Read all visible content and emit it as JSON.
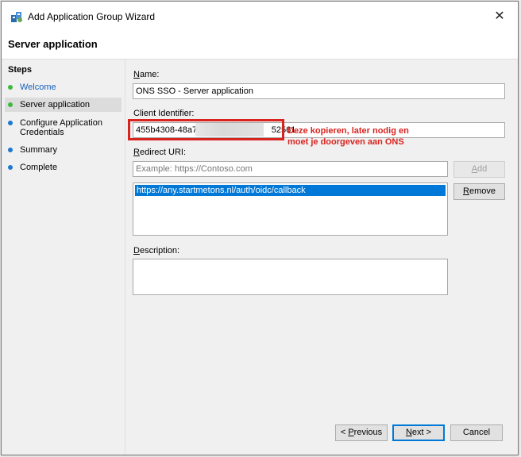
{
  "window": {
    "title": "Add Application Group Wizard",
    "close_symbol": "✕"
  },
  "header": {
    "title": "Server application"
  },
  "steps": {
    "title": "Steps",
    "items": [
      {
        "label": "Welcome",
        "state": "done"
      },
      {
        "label": "Server application",
        "state": "current"
      },
      {
        "label": "Configure Application Credentials",
        "state": "pending"
      },
      {
        "label": "Summary",
        "state": "pending"
      },
      {
        "label": "Complete",
        "state": "pending"
      }
    ]
  },
  "form": {
    "name_label_first": "N",
    "name_label_rest": "ame:",
    "name_value": "ONS SSO - Server application",
    "client_id_label": "Client Identifier:",
    "client_id_prefix": "455b4308-48a7-",
    "client_id_suffix": "52561",
    "redirect_label_first": "R",
    "redirect_label_rest": "edirect URI:",
    "redirect_placeholder": "Example: https://Contoso.com",
    "add_first": "A",
    "add_rest": "dd",
    "redirect_items": [
      "https://any.startmetons.nl/auth/oidc/callback"
    ],
    "remove_first": "R",
    "remove_rest": "emove",
    "description_label_first": "D",
    "description_label_rest": "escription:",
    "description_value": ""
  },
  "annotation": {
    "line1": "Deze kopieren, later nodig en",
    "line2": "moet je doorgeven aan ONS"
  },
  "footer": {
    "prev_a": "< ",
    "prev_u": "P",
    "prev_b": "revious",
    "next_u": "N",
    "next_b": "ext >",
    "cancel": "Cancel"
  },
  "colors": {
    "accent": "#0078d7",
    "annotation": "#d9231f",
    "done_dot": "#3cba3c",
    "pending_dot": "#1e78d2"
  }
}
